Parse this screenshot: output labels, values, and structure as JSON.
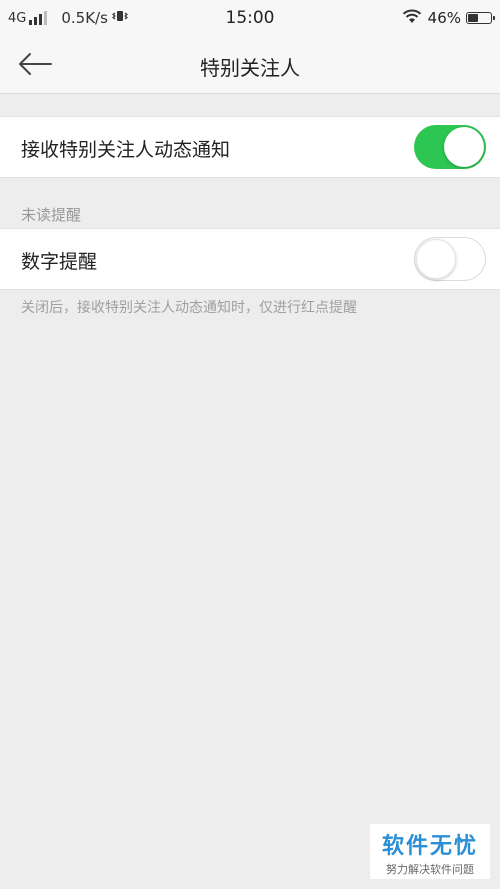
{
  "status_bar": {
    "network_type": "4G",
    "speed": "0.5K/s",
    "time": "15:00",
    "battery_percent": "46%",
    "battery_level": 0.46,
    "icons": [
      "signal-icon",
      "vibrate-icon",
      "wifi-icon",
      "battery-icon"
    ]
  },
  "nav": {
    "back_icon": "back-arrow-icon",
    "title": "特别关注人"
  },
  "settings": {
    "notify_row": {
      "label": "接收特别关注人动态通知",
      "toggle_on": true
    },
    "unread_section": {
      "header": "未读提醒"
    },
    "digit_row": {
      "label": "数字提醒",
      "toggle_on": false
    },
    "hint": "关闭后，接收特别关注人动态通知时，仅进行红点提醒"
  },
  "watermark": {
    "title": "软件无忧",
    "subtitle": "努力解决软件问题"
  },
  "colors": {
    "accent_green": "#2dc653",
    "background": "#ededed",
    "watermark_blue": "#2b8fd6"
  }
}
